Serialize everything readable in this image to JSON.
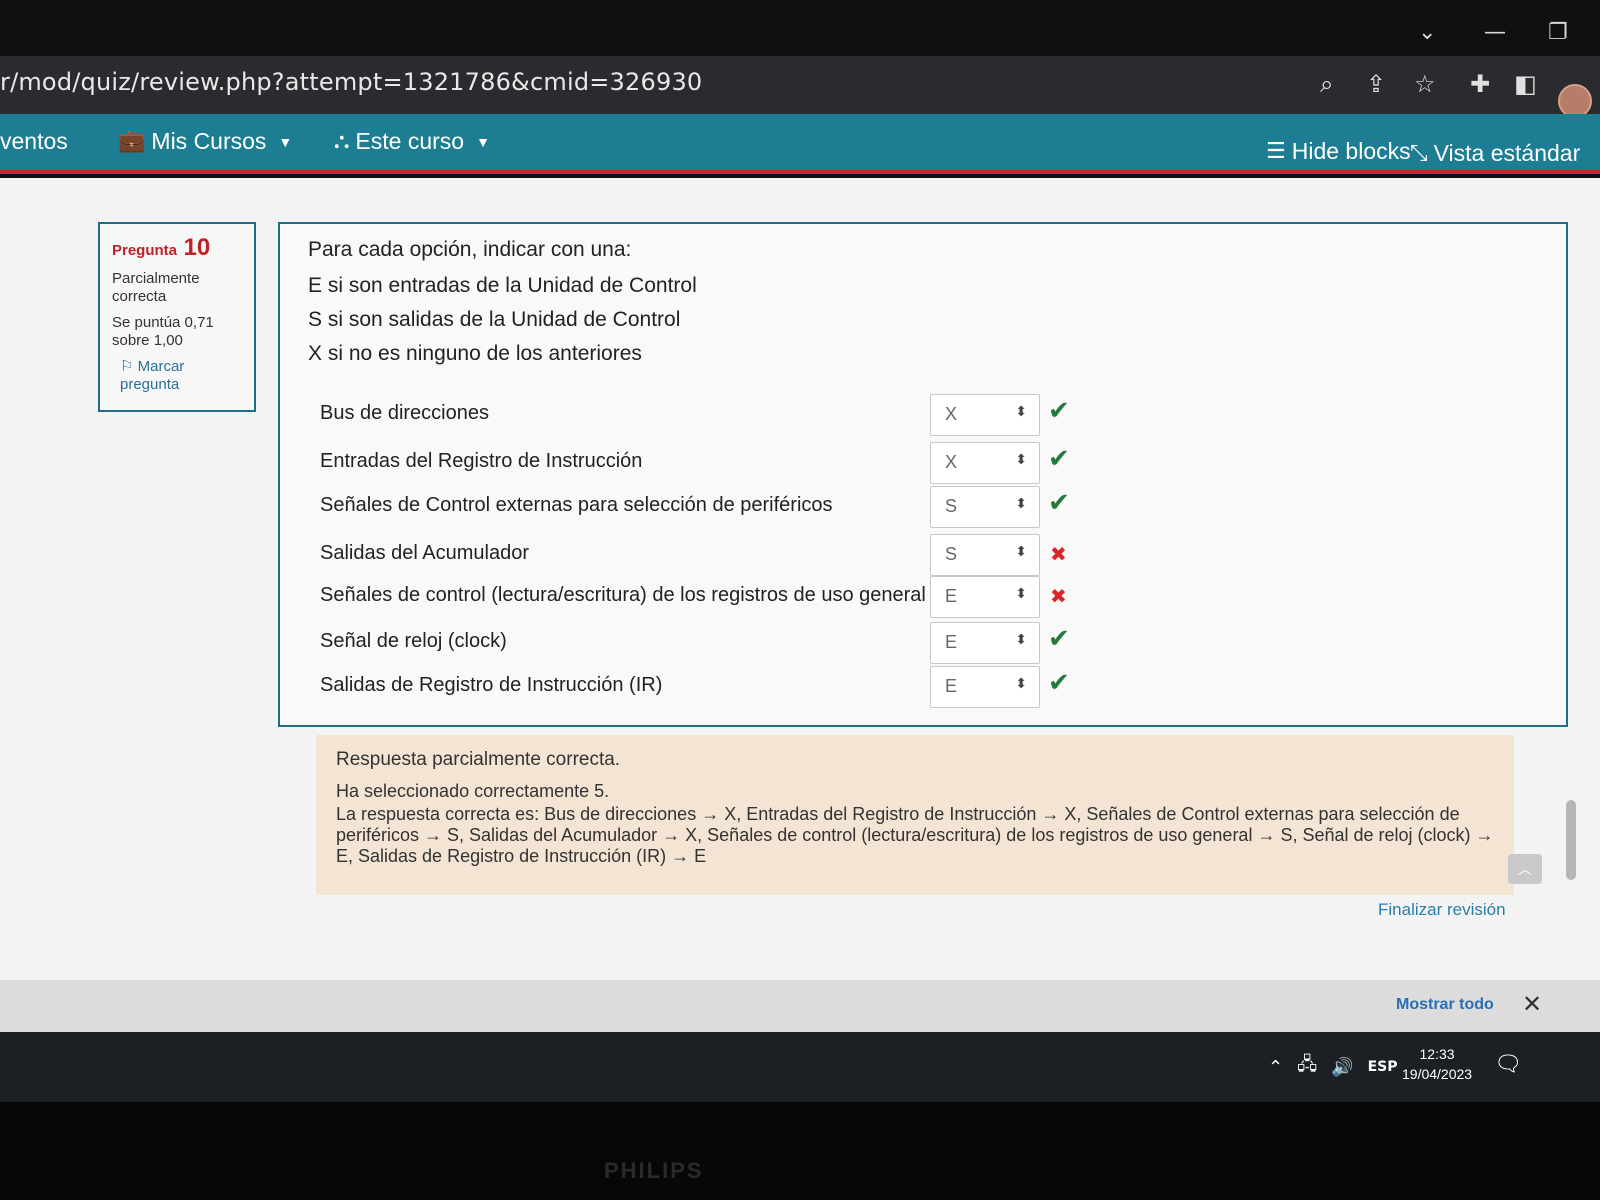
{
  "window": {
    "controls": {
      "chevron": "⌄",
      "minimize": "—",
      "restore": "❐"
    }
  },
  "address_bar": {
    "url": "r/mod/quiz/review.php?attempt=1321786&cmid=326930",
    "icons": [
      "zoom-icon",
      "share-icon",
      "star-icon",
      "extensions-icon",
      "sidepanel-icon"
    ]
  },
  "navbar": {
    "items": [
      {
        "label": "ventos",
        "icon": ""
      },
      {
        "label": "Mis Cursos",
        "icon": "briefcase-icon"
      },
      {
        "label": "Este curso",
        "icon": "sitemap-icon"
      }
    ],
    "hide_blocks": "Hide blocks",
    "vista": "Vista estándar",
    "accent_color": "#1d7e93",
    "border_color": "#c9262c"
  },
  "question_info": {
    "label": "Pregunta",
    "number": "10",
    "state": "Parcialmente correcta",
    "grade": "Se puntúa 0,71 sobre 1,00",
    "flag": "Marcar pregunta"
  },
  "question": {
    "prompt": [
      "Para cada opción, indicar con una:",
      "E si son entradas de la Unidad de Control",
      "S si son salidas de la Unidad de Control",
      "X si no es ninguno de los anteriores"
    ],
    "rows": [
      {
        "label": "Bus de direcciones",
        "value": "X",
        "correct": true
      },
      {
        "label": "Entradas del Registro de Instrucción",
        "value": "X",
        "correct": true
      },
      {
        "label": "Señales de Control externas para selección de periféricos",
        "value": "S",
        "correct": true
      },
      {
        "label": "Salidas del Acumulador",
        "value": "S",
        "correct": false
      },
      {
        "label": "Señales de control (lectura/escritura) de los registros de uso general",
        "value": "E",
        "correct": false
      },
      {
        "label": "Señal de reloj (clock)",
        "value": "E",
        "correct": true
      },
      {
        "label": "Salidas de Registro de Instrucción (IR)",
        "value": "E",
        "correct": true
      }
    ]
  },
  "feedback": {
    "title": "Respuesta parcialmente correcta.",
    "selected": "Ha seleccionado correctamente 5.",
    "correct_answer": "La respuesta correcta es: Bus de direcciones → X, Entradas del Registro de Instrucción → X, Señales de Control externas para selección de periféricos → S, Salidas del Acumulador → X, Señales de control (lectura/escritura) de los registros de uso general → S, Señal de reloj (clock) → E, Salidas de Registro de Instrucción (IR) → E"
  },
  "finalize": "Finalizar revisión",
  "downloads": {
    "show_all": "Mostrar todo"
  },
  "taskbar": {
    "lang": "ESP",
    "time": "12:33",
    "date": "19/04/2023"
  },
  "monitor_brand": "PHILIPS"
}
